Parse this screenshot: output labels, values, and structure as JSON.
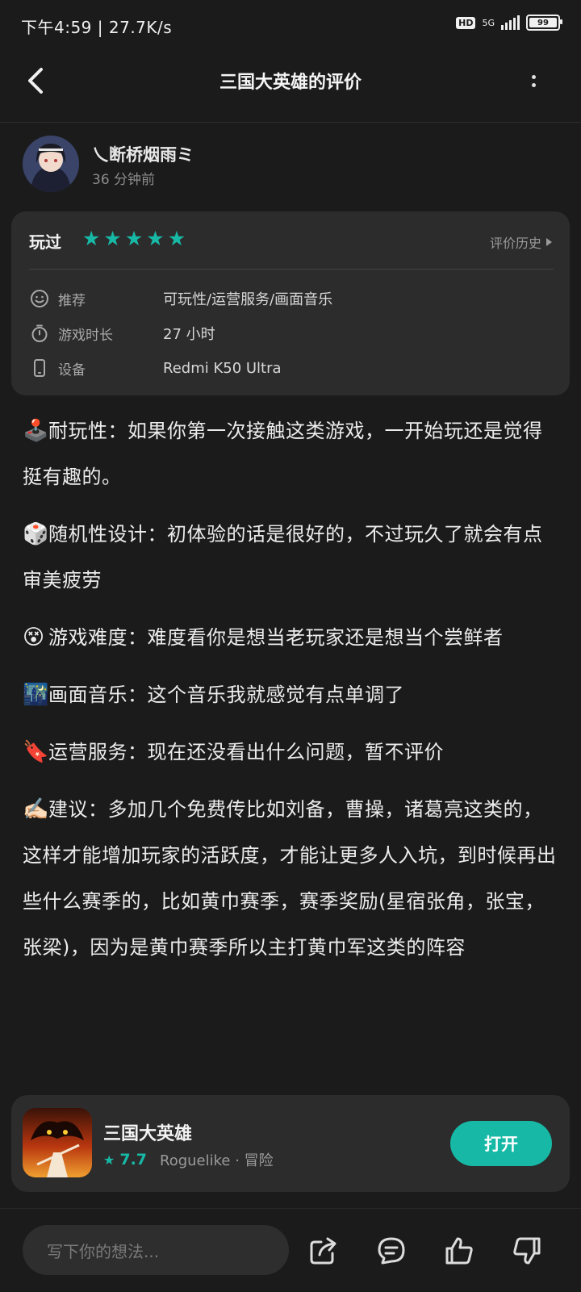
{
  "status_bar": {
    "time": "下午4:59 | 27.7K/s",
    "hd": "HD",
    "network": "5G",
    "battery": "99"
  },
  "nav": {
    "title": "三国大英雄的评价"
  },
  "author": {
    "name": "乀断桥烟雨ミ",
    "time": "36 分钟前"
  },
  "review_card": {
    "played_label": "玩过",
    "stars": 5,
    "history_label": "评价历史",
    "rows": [
      {
        "key": "推荐",
        "value": "可玩性/运营服务/画面音乐",
        "icon": "smile-icon"
      },
      {
        "key": "游戏时长",
        "value": "27 小时",
        "icon": "stopwatch-icon"
      },
      {
        "key": "设备",
        "value": "Redmi K50 Ultra",
        "icon": "phone-icon"
      }
    ]
  },
  "review": {
    "paragraphs": [
      {
        "emoji": "🕹️",
        "text": "耐玩性：如果你第一次接触这类游戏，一开始玩还是觉得挺有趣的。"
      },
      {
        "emoji": "🎲",
        "text": "随机性设计：初体验的话是很好的，不过玩久了就会有点审美疲劳"
      },
      {
        "emoji": "😵",
        "text": "游戏难度：难度看你是想当老玩家还是想当个尝鲜者"
      },
      {
        "emoji": "🌃",
        "text": "画面音乐：这个音乐我就感觉有点单调了"
      },
      {
        "emoji": "🔖",
        "text": "运营服务：现在还没看出什么问题，暂不评价"
      },
      {
        "emoji": "✍🏻",
        "text": "建议：多加几个免费传比如刘备，曹操，诸葛亮这类的，这样才能增加玩家的活跃度，才能让更多人入坑，到时候再出些什么赛季的，比如黄巾赛季，赛季奖励(星宿张角，张宝，张梁)，因为是黄巾赛季所以主打黄巾军这类的阵容"
      }
    ]
  },
  "game": {
    "name": "三国大英雄",
    "rating": "7.7",
    "tags": "Roguelike · 冒险",
    "open_label": "打开"
  },
  "bottom_bar": {
    "placeholder": "写下你的想法..."
  },
  "colors": {
    "accent": "#17b9a6",
    "background": "#1b1b1b",
    "card": "#2c2c2c"
  }
}
